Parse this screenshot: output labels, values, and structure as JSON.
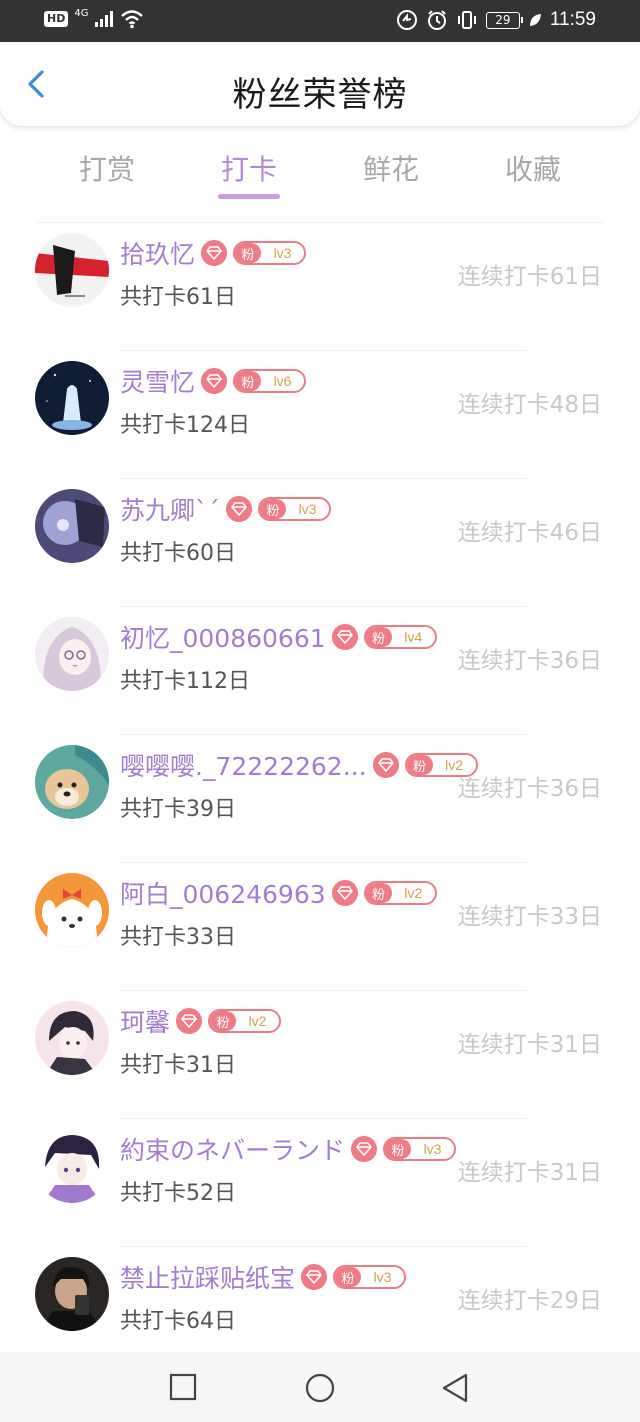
{
  "status_bar": {
    "hd": "HD",
    "network": "4G",
    "battery": "29",
    "time": "11:59"
  },
  "header": {
    "title": "粉丝荣誉榜"
  },
  "tabs": [
    {
      "label": "打赏",
      "active": false
    },
    {
      "label": "打卡",
      "active": true
    },
    {
      "label": "鲜花",
      "active": false
    },
    {
      "label": "收藏",
      "active": false
    }
  ],
  "badge_fen": "粉",
  "colors": {
    "accent": "#b38ad6",
    "badge": "#ee7c86",
    "level_text": "#d4a24a"
  },
  "rows": [
    {
      "name": "拾玖忆",
      "level": "lv3",
      "total": "共打卡61日",
      "streak": "连续打卡61日"
    },
    {
      "name": "灵雪忆",
      "level": "lv6",
      "total": "共打卡124日",
      "streak": "连续打卡48日"
    },
    {
      "name": "苏九卿ˋˊ",
      "level": "lv3",
      "total": "共打卡60日",
      "streak": "连续打卡46日"
    },
    {
      "name": "初忆_000860661",
      "level": "lv4",
      "total": "共打卡112日",
      "streak": "连续打卡36日"
    },
    {
      "name": "嘤嘤嘤._72222262...",
      "level": "lv2",
      "total": "共打卡39日",
      "streak": "连续打卡36日"
    },
    {
      "name": "阿白_006246963",
      "level": "lv2",
      "total": "共打卡33日",
      "streak": "连续打卡33日"
    },
    {
      "name": "珂馨",
      "level": "lv2",
      "total": "共打卡31日",
      "streak": "连续打卡31日"
    },
    {
      "name": "約束のネバーランド",
      "level": "lv3",
      "total": "共打卡52日",
      "streak": "连续打卡31日"
    },
    {
      "name": "禁止拉踩贴纸宝",
      "level": "lv3",
      "total": "共打卡64日",
      "streak": "连续打卡29日"
    }
  ]
}
